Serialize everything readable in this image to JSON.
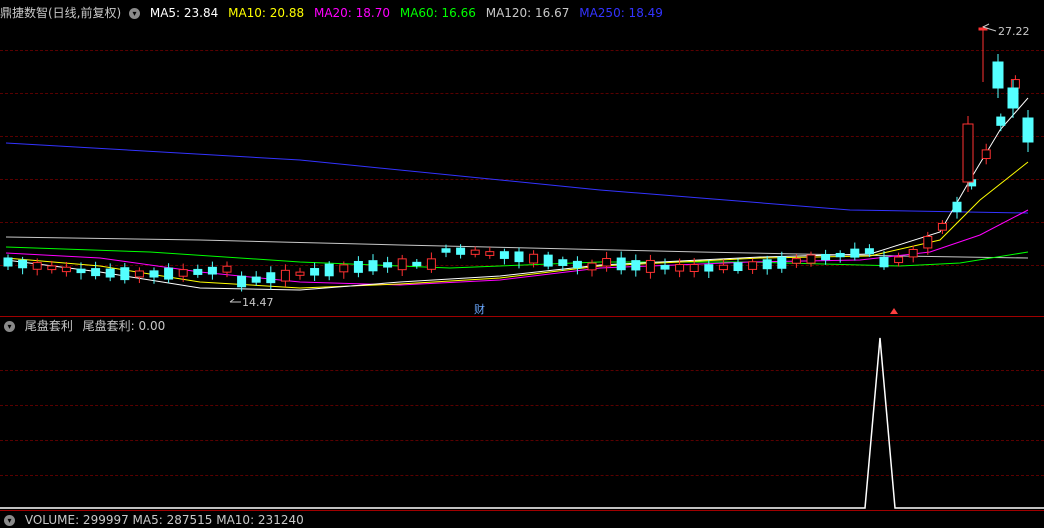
{
  "main_panel": {
    "title": "鼎捷数智(日线,前复权)",
    "indicators": [
      {
        "label": "MA5: 23.84",
        "color": "#ffffff"
      },
      {
        "label": "MA10: 20.88",
        "color": "#ffff00"
      },
      {
        "label": "MA20: 18.70",
        "color": "#ff00ff"
      },
      {
        "label": "MA60: 16.66",
        "color": "#00ff00"
      },
      {
        "label": "MA120: 16.67",
        "color": "#c8c8c8"
      },
      {
        "label": "MA250: 18.49",
        "color": "#3333ff"
      }
    ],
    "high_label": "27.22",
    "low_label": "14.47",
    "event_marker": "财"
  },
  "indicator_panel": {
    "title": "尾盘套利",
    "value_label": "尾盘套利: 0.00"
  },
  "volume_panel": {
    "label": "VOLUME: 299997  MA5: 287515  MA10: 231240"
  },
  "colors": {
    "up": "#ff3232",
    "down": "#54ffff",
    "ma5": "#ffffff",
    "ma10": "#ffff00",
    "ma20": "#ff00ff",
    "ma60": "#00ff00",
    "ma120": "#c8c8c8",
    "ma250": "#3333ff"
  }
}
